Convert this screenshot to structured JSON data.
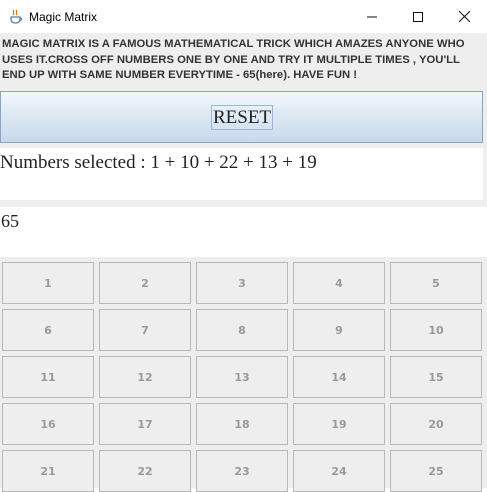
{
  "window": {
    "title": "Magic Matrix",
    "icon": "java-coffee-cup-icon",
    "controls": {
      "minimize": "—",
      "maximize": "☐",
      "close": "✕"
    }
  },
  "intro_text": "MAGIC MATRIX IS A FAMOUS MATHEMATICAL TRICK WHICH AMAZES ANYONE WHO USES IT.CROSS OFF NUMBERS ONE BY ONE AND TRY IT MULTIPLE TIMES , YOU'LL END UP WITH SAME NUMBER EVERYTIME - 65(here). HAVE FUN !",
  "reset_label": "RESET",
  "selected_text": "Numbers selected : 1 + 10 + 22 + 13 + 19",
  "result": "65",
  "grid": {
    "rows": [
      [
        "1",
        "2",
        "3",
        "4",
        "5"
      ],
      [
        "6",
        "7",
        "8",
        "9",
        "10"
      ],
      [
        "11",
        "12",
        "13",
        "14",
        "15"
      ],
      [
        "16",
        "17",
        "18",
        "19",
        "20"
      ],
      [
        "21",
        "22",
        "23",
        "24",
        "25"
      ]
    ]
  },
  "colors": {
    "panel_bg": "#eeeeee",
    "reset_bar_gradient_top": "#f4f8fc",
    "reset_bar_gradient_bottom": "#c9d9ea",
    "disabled_text": "#9a9a9a"
  }
}
